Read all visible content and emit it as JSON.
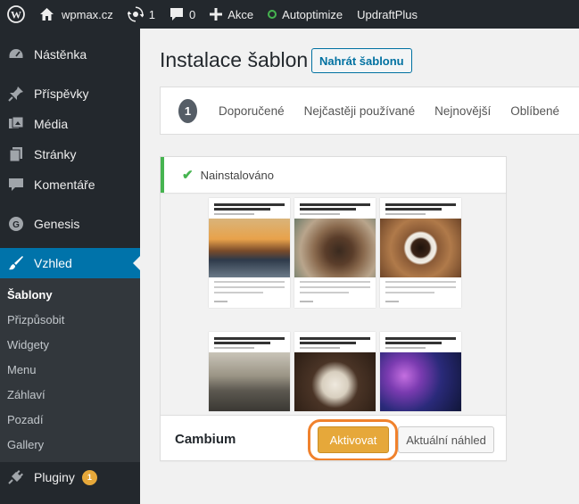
{
  "adminbar": {
    "site_name": "wpmax.cz",
    "updates_count": "1",
    "comments_count": "0",
    "new_label": "Akce",
    "autoptimize_label": "Autoptimize",
    "updraft_label": "UpdraftPlus"
  },
  "sidebar": {
    "dashboard": "Nástěnka",
    "posts": "Příspěvky",
    "media": "Média",
    "pages": "Stránky",
    "comments": "Komentáře",
    "genesis": "Genesis",
    "appearance": "Vzhled",
    "submenu": [
      "Šablony",
      "Přizpůsobit",
      "Widgety",
      "Menu",
      "Záhlaví",
      "Pozadí",
      "Gallery"
    ],
    "plugins": "Pluginy",
    "plugins_badge": "1"
  },
  "page": {
    "title": "Instalace šablon",
    "upload_button": "Nahrát šablonu"
  },
  "filters": {
    "count": "1",
    "items": [
      "Doporučené",
      "Nejčastěji používané",
      "Nejnovější",
      "Oblíbené"
    ]
  },
  "theme": {
    "notice": "Nainstalováno",
    "name": "Cambium",
    "activate_label": "Aktivovat",
    "preview_label": "Aktuální náhled"
  },
  "colors": {
    "adminbar_bg": "#23282d",
    "current_menu": "#0073aa",
    "activate_button": "#e6a83a",
    "highlight": "#f0822d",
    "installed_green": "#46b450"
  }
}
